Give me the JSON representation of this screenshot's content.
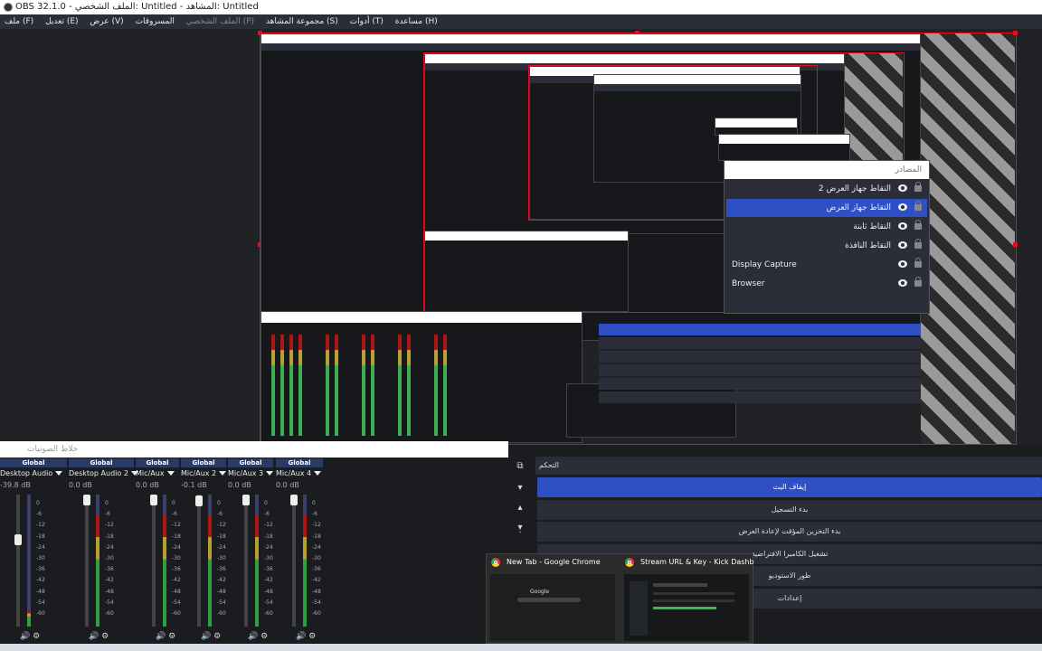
{
  "window": {
    "title": "OBS 32.1.0 - الملف الشخصي: Untitled - المشاهد: Untitled"
  },
  "menu": [
    {
      "label": "ملف (F)"
    },
    {
      "label": "تعديل (E)"
    },
    {
      "label": "عرض (V)"
    },
    {
      "label": "المسروقات"
    },
    {
      "label": "الملف الشخصي (P)",
      "disabled": true
    },
    {
      "label": "مجموعة المشاهد (S)"
    },
    {
      "label": "أدوات (T)"
    },
    {
      "label": "مساعدة (H)"
    }
  ],
  "sources": {
    "header": "المصادر",
    "items": [
      {
        "label": "التقاط جهاز العرض 2",
        "rtl": true,
        "selected": false
      },
      {
        "label": "التقاط جهاز العرض",
        "rtl": true,
        "selected": true
      },
      {
        "label": "التقاط ثابتة",
        "rtl": true,
        "selected": false
      },
      {
        "label": "التقاط النافذة",
        "rtl": true,
        "selected": false
      },
      {
        "label": "Display Capture",
        "rtl": false,
        "selected": false
      },
      {
        "label": "Browser",
        "rtl": false,
        "selected": false
      }
    ]
  },
  "mixer": {
    "header": "خلاط الصوتيات",
    "scale": [
      "0",
      "-6",
      "-12",
      "-18",
      "-24",
      "-30",
      "-36",
      "-42",
      "-48",
      "-54",
      "-60"
    ],
    "channels": [
      {
        "badge": "Global",
        "name": "Desktop Audio",
        "db": "-39.8 dB",
        "level": 0.12,
        "fader": 0.67
      },
      {
        "badge": "Global",
        "name": "Desktop Audio 2",
        "db": "0.0 dB",
        "level": 0.85,
        "fader": 1.0
      },
      {
        "badge": "Global",
        "name": "Mic/Aux",
        "db": "0.0 dB",
        "level": 0.85,
        "fader": 1.0
      },
      {
        "badge": "Global",
        "name": "Mic/Aux 2",
        "db": "-0.1 dB",
        "level": 0.85,
        "fader": 0.99
      },
      {
        "badge": "Global",
        "name": "Mic/Aux 3",
        "db": "0.0 dB",
        "level": 0.85,
        "fader": 1.0
      },
      {
        "badge": "Global",
        "name": "Mic/Aux 4",
        "db": "0.0 dB",
        "level": 0.85,
        "fader": 1.0
      }
    ]
  },
  "controls": {
    "header": "التحكم",
    "buttons": [
      {
        "label": "إيقاف البث",
        "active": true
      },
      {
        "label": "بدء التسجيل",
        "active": false
      },
      {
        "label": "بدء التخزين المؤقت لإعادة العرض",
        "active": false
      },
      {
        "label": "تشغيل الكاميرا الافتراضية",
        "active": false
      },
      {
        "label": "طور الاستوديو",
        "active": false
      },
      {
        "label": "إعدادات",
        "active": false
      }
    ]
  },
  "taskbar_preview": {
    "items": [
      {
        "title": "New Tab - Google Chrome",
        "content": "Google"
      },
      {
        "title": "Stream URL & Key - Kick Dashb..."
      }
    ]
  },
  "colors": {
    "accent": "#2f4fc4",
    "selection_red": "#e01020",
    "panel": "#2b2e38",
    "background": "#1b1c20"
  }
}
